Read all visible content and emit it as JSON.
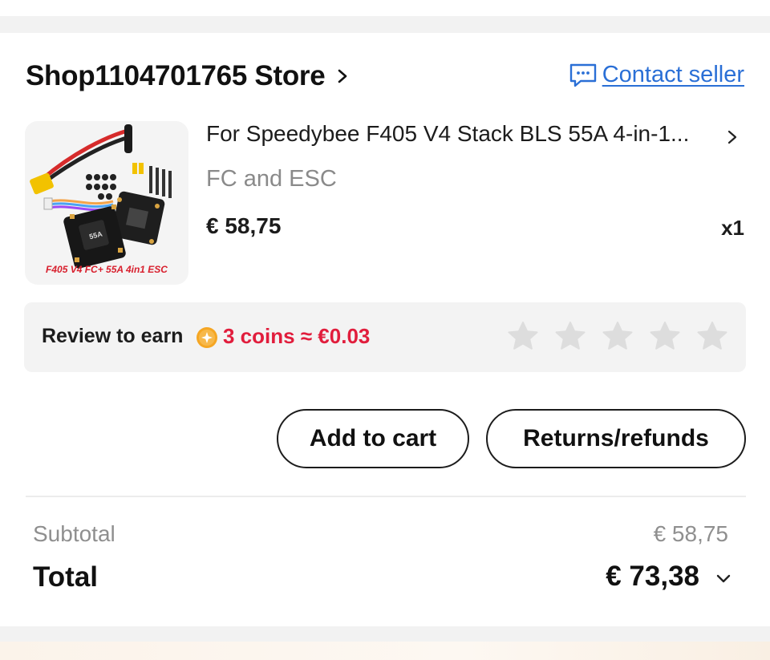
{
  "store": {
    "name": "Shop1104701765 Store",
    "contact_label": "Contact seller"
  },
  "product": {
    "title": "For Speedybee F405 V4 Stack BLS 55A 4-in-1...",
    "variant": "FC and ESC",
    "price": "€ 58,75",
    "quantity": "x1",
    "image_caption": "F405 V4 FC+ 55A 4in1 ESC"
  },
  "review": {
    "label": "Review to earn",
    "reward": "3 coins ≈ €0.03",
    "stars_total": 5,
    "stars_selected": 0
  },
  "actions": {
    "add_to_cart": "Add to cart",
    "returns": "Returns/refunds"
  },
  "summary": {
    "subtotal_label": "Subtotal",
    "subtotal_value": "€ 58,75",
    "total_label": "Total",
    "total_value": "€ 73,38"
  },
  "colors": {
    "link": "#2a6fd6",
    "reward": "#e11d3c",
    "coin": "#f5a623"
  }
}
